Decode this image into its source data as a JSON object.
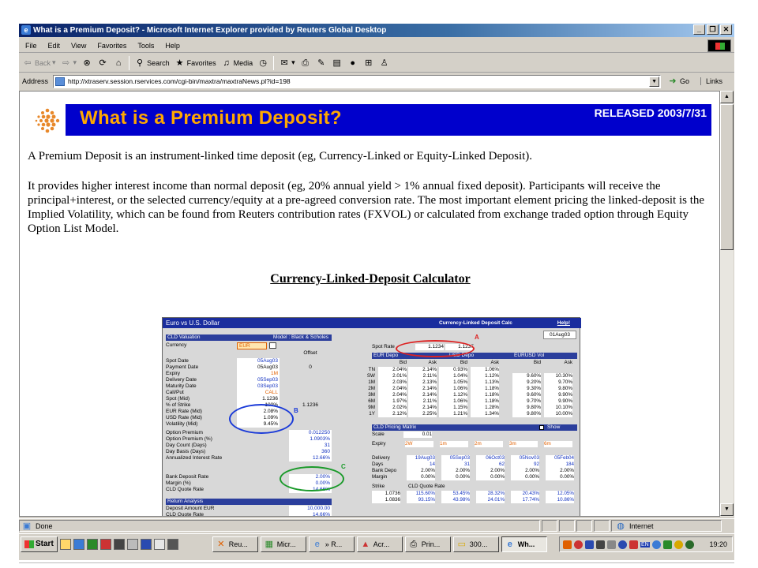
{
  "window": {
    "title": "What is a Premium Deposit? - Microsoft Internet Explorer provided by Reuters Global Desktop"
  },
  "menu": [
    "File",
    "Edit",
    "View",
    "Favorites",
    "Tools",
    "Help"
  ],
  "toolbar": {
    "back": "Back",
    "search": "Search",
    "favorites": "Favorites",
    "media": "Media"
  },
  "address": {
    "label": "Address",
    "url": "http://xtraserv.session.rservices.com/cgi-bin/maxtra/maxtraNews.pl?id=198",
    "go": "Go",
    "links": "Links"
  },
  "page": {
    "banner_title": "What is a Premium Deposit?",
    "released": "RELEASED 2003/7/31",
    "para1": "A Premium Deposit is an instrument-linked time deposit (eg, Currency-Linked or Equity-Linked Deposit).",
    "para2": "It provides higher interest income than normal deposit (eg, 20% annual yield > 1% annual fixed deposit). Participants will receive the principal+interest, or the selected currency/equity at a pre-agreed conversion rate. The most important element pricing the linked-deposit is the Implied Volatility, which can be found from Reuters contribution rates (FXVOL) or calculated from exchange traded option through Equity Option List Model.",
    "calc_title": "Currency-Linked-Deposit Calculator"
  },
  "calculator": {
    "header": "Euro vs U.S. Dollar",
    "header_mid": "Currency-Linked Deposit Calc",
    "help": "Help!",
    "date": "01Aug03",
    "valuation_title": "CLD Valuation",
    "model": "Model : Black & Scholes",
    "currency_label": "Currency",
    "currency_value": "EUR",
    "offset_label": "Offset",
    "left_rows": [
      {
        "label": "Spot Date",
        "v1": "05Aug03",
        "v2": "",
        "c": "blue"
      },
      {
        "label": "Payment Date",
        "v1": "05Aug03",
        "v2": "0",
        "c": ""
      },
      {
        "label": "Expiry",
        "v1": "1M",
        "v2": "",
        "c": "org"
      },
      {
        "label": "Delivery Date",
        "v1": "05Sep03",
        "v2": "",
        "c": "blue"
      },
      {
        "label": "Maturity Date",
        "v1": "03Sep03",
        "v2": "",
        "c": "blue"
      },
      {
        "label": "Call/Put",
        "v1": "CALL",
        "v2": "",
        "c": "org"
      },
      {
        "label": "Spot (Mid)",
        "v1": "1.1236",
        "v2": "",
        "c": ""
      },
      {
        "label": "% of Strike",
        "v1": "100%",
        "v2": "1.1236",
        "c": ""
      },
      {
        "label": "EUR Rate (Mid)",
        "v1": "2.08%",
        "v2": "",
        "c": ""
      },
      {
        "label": "USD Rate (Mid)",
        "v1": "1.09%",
        "v2": "",
        "c": ""
      },
      {
        "label": "Volatility (Mid)",
        "v1": "9.45%",
        "v2": "",
        "c": ""
      }
    ],
    "premium_rows": [
      {
        "label": "Option Premium",
        "v1": "",
        "v2": "0.012250"
      },
      {
        "label": "Option Premium (%)",
        "v1": "",
        "v2": "1.0903%"
      },
      {
        "label": "Day Count (Days)",
        "v1": "",
        "v2": "31"
      },
      {
        "label": "Day Basis (Days)",
        "v1": "",
        "v2": "360"
      },
      {
        "label": "Annualized Interest Rate",
        "v1": "",
        "v2": "12.66%"
      }
    ],
    "deposit_rows": [
      {
        "label": "Bank Deposit Rate",
        "v2": "2.00%"
      },
      {
        "label": "Margin (%)",
        "v2": "0.00%"
      },
      {
        "label": "CLD Quote Rate",
        "v2": "14.66%"
      }
    ],
    "return_title": "Return Analysis",
    "return_rows": [
      {
        "label": "Deposit Amount EUR",
        "v2": "10,000.00"
      },
      {
        "label": "CLD Quote Rate",
        "v2": "14.66%"
      }
    ],
    "spot_rate_label": "Spot Rate",
    "spot_bid": "1.1234",
    "spot_ask": "1.1237",
    "depo_headers": [
      "EUR Depo",
      "USD Depo",
      "EURUSD Vol"
    ],
    "depo_sub": [
      "Bid",
      "Ask",
      "Bid",
      "Ask",
      "Bid",
      "Ask"
    ],
    "depo_rows": [
      [
        "TN",
        "2.04%",
        "2.14%",
        "0.93%",
        "1.06%",
        "",
        ""
      ],
      [
        "SW",
        "2.01%",
        "2.11%",
        "1.04%",
        "1.12%",
        "9.60%",
        "10.30%"
      ],
      [
        "1M",
        "2.03%",
        "2.13%",
        "1.05%",
        "1.13%",
        "9.20%",
        "9.70%"
      ],
      [
        "2M",
        "2.04%",
        "2.14%",
        "1.06%",
        "1.18%",
        "9.30%",
        "9.80%"
      ],
      [
        "3M",
        "2.04%",
        "2.14%",
        "1.12%",
        "1.18%",
        "9.60%",
        "9.90%"
      ],
      [
        "6M",
        "1.97%",
        "2.11%",
        "1.06%",
        "1.18%",
        "9.70%",
        "9.90%"
      ],
      [
        "9M",
        "2.02%",
        "2.14%",
        "1.15%",
        "1.28%",
        "9.80%",
        "10.10%"
      ],
      [
        "1Y",
        "2.12%",
        "2.25%",
        "1.21%",
        "1.34%",
        "9.80%",
        "10.00%"
      ]
    ],
    "matrix_title": "CLD Pricing Matrix",
    "matrix_show": "Show",
    "scale_label": "Scale",
    "scale_value": "0.01",
    "expiry_label": "Expiry",
    "expiries": [
      "2W",
      "1m",
      "2m",
      "3m",
      "6m"
    ],
    "matrix_rows": [
      {
        "label": "Delivery",
        "vals": [
          "19Aug03",
          "05Sep03",
          "06Oct03",
          "05Nov03",
          "05Feb04"
        ]
      },
      {
        "label": "Days",
        "vals": [
          "14",
          "31",
          "62",
          "92",
          "184"
        ]
      },
      {
        "label": "Bank Depo",
        "vals": [
          "2.00%",
          "2.00%",
          "2.00%",
          "2.00%",
          "2.00%"
        ]
      },
      {
        "label": "Margin",
        "vals": [
          "0.00%",
          "0.00%",
          "0.00%",
          "0.00%",
          "0.00%"
        ]
      }
    ],
    "strike_label": "Strike",
    "quote_label": "CLD Quote Rate",
    "strike_rows": [
      {
        "strike": "1.0736",
        "vals": [
          "115.60%",
          "53.45%",
          "28.32%",
          "20.43%",
          "12.05%"
        ]
      },
      {
        "strike": "1.0836",
        "vals": [
          "93.15%",
          "43.98%",
          "24.01%",
          "17.74%",
          "10.86%"
        ]
      }
    ],
    "marker_a": "A",
    "marker_b": "B",
    "marker_c": "C"
  },
  "status": {
    "text": "Done",
    "zone": "Internet"
  },
  "taskbar": {
    "start": "Start",
    "tasks": [
      "Reu...",
      "Micr...",
      "» R...",
      "Acr...",
      "Prin...",
      "300...",
      "Wh..."
    ],
    "tray_lang": "EN",
    "clock": "19:20"
  },
  "colors": {
    "banner": "#0000cc",
    "banner_title": "#ffa800",
    "marker_a": "#dd2222",
    "marker_b": "#1a3ad8",
    "marker_c": "#1a9a2a"
  }
}
